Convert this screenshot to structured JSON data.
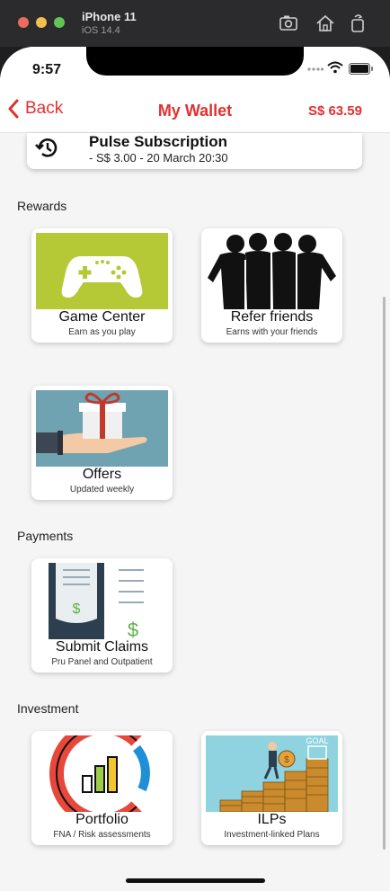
{
  "simulator": {
    "device": "iPhone 11",
    "os": "iOS 14.4"
  },
  "status_bar": {
    "time": "9:57"
  },
  "nav": {
    "back_label": "Back",
    "title": "My Wallet",
    "balance": "S$ 63.59"
  },
  "subscription": {
    "title": "Pulse Subscription",
    "detail": "- S$ 3.00 - 20 March 20:30"
  },
  "sections": {
    "rewards": {
      "label": "Rewards",
      "cards": [
        {
          "title": "Game Center",
          "desc": "Earn as you play"
        },
        {
          "title": "Refer friends",
          "desc": "Earns with your friends"
        },
        {
          "title": "Offers",
          "desc": "Updated weekly"
        }
      ]
    },
    "payments": {
      "label": "Payments",
      "cards": [
        {
          "title": "Submit Claims",
          "desc": "Pru Panel and Outpatient"
        }
      ]
    },
    "investment": {
      "label": "Investment",
      "cards": [
        {
          "title": "Portfolio",
          "desc": "FNA / Risk assessments"
        },
        {
          "title": "ILPs",
          "desc": "Investment-linked Plans"
        }
      ]
    }
  },
  "colors": {
    "accent": "#e0312f",
    "game_green": "#b5c936",
    "offers_teal": "#6fa3b2",
    "ilps_sky": "#8fd3e0"
  },
  "ilps_goal_label": "GOAL"
}
